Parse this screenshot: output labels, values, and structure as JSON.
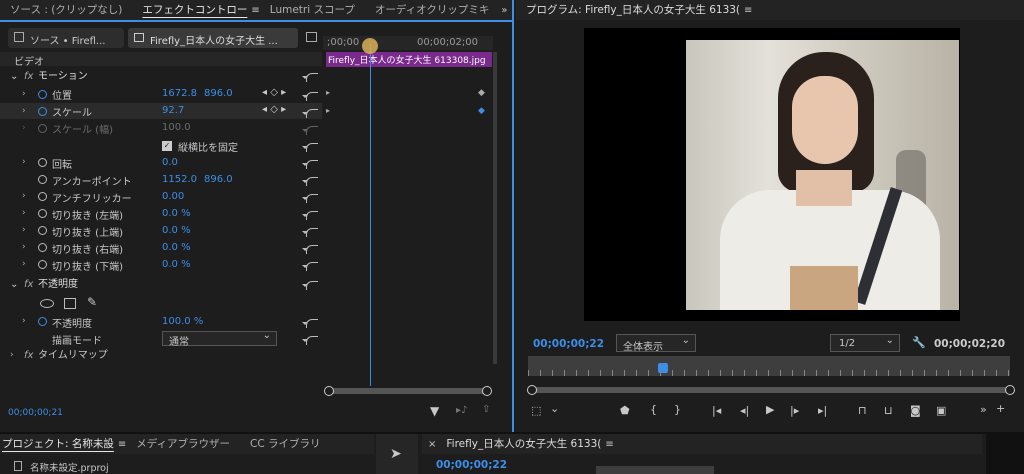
{
  "left_tabs": {
    "source": "ソース : (クリップなし)",
    "effect": "エフェクトコントロー",
    "lumetri": "Lumetri スコープ",
    "audio": "オーディオクリップミキ"
  },
  "program_tab": "プログラム: Firefly_日本人の女子大生 6133(",
  "source_tab": "ソース • Firefl...",
  "clip_tab": "Firefly_日本人の女子大生 ...",
  "time_start": ";00;00",
  "time_end": "00;00;02;00",
  "video_label": "ビデオ",
  "clip_name": "Firefly_日本人の女子大生 613308.jpg",
  "motion": "モーション",
  "fx": "fx",
  "props": {
    "position": {
      "label": "位置",
      "v1": "1672.8",
      "v2": "896.0"
    },
    "scale": {
      "label": "スケール",
      "v1": "92.7"
    },
    "scale_w": {
      "label": "スケール (幅)",
      "v1": "100.0"
    },
    "uniform": "縦横比を固定",
    "rotation": {
      "label": "回転",
      "v1": "0.0"
    },
    "anchor": {
      "label": "アンカーポイント",
      "v1": "1152.0",
      "v2": "896.0"
    },
    "flicker": {
      "label": "アンチフリッカー",
      "v1": "0.00"
    },
    "crop_l": {
      "label": "切り抜き (左端)",
      "v1": "0.0 %"
    },
    "crop_t": {
      "label": "切り抜き (上端)",
      "v1": "0.0 %"
    },
    "crop_r": {
      "label": "切り抜き (右端)",
      "v1": "0.0 %"
    },
    "crop_b": {
      "label": "切り抜き (下端)",
      "v1": "0.0 %"
    }
  },
  "opacity_section": "不透明度",
  "opacity": {
    "label": "不透明度",
    "v1": "100.0 %"
  },
  "blend": {
    "label": "描画モード",
    "value": "通常"
  },
  "timeremap": "タイムリマップ",
  "current_time": "00;00;00;21",
  "program": {
    "time": "00;00;00;22",
    "fit": "全体表示",
    "res": "1/2",
    "duration": "00;00;02;20"
  },
  "bottom": {
    "project": "プロジェクト: 名称未設",
    "media": "メディアブラウザー",
    "cc": "CC ライブラリ",
    "file": "名称未設定.prproj",
    "seq_tab": "Firefly_日本人の女子大生 6133(",
    "seq_time": "00;00;00;22"
  }
}
